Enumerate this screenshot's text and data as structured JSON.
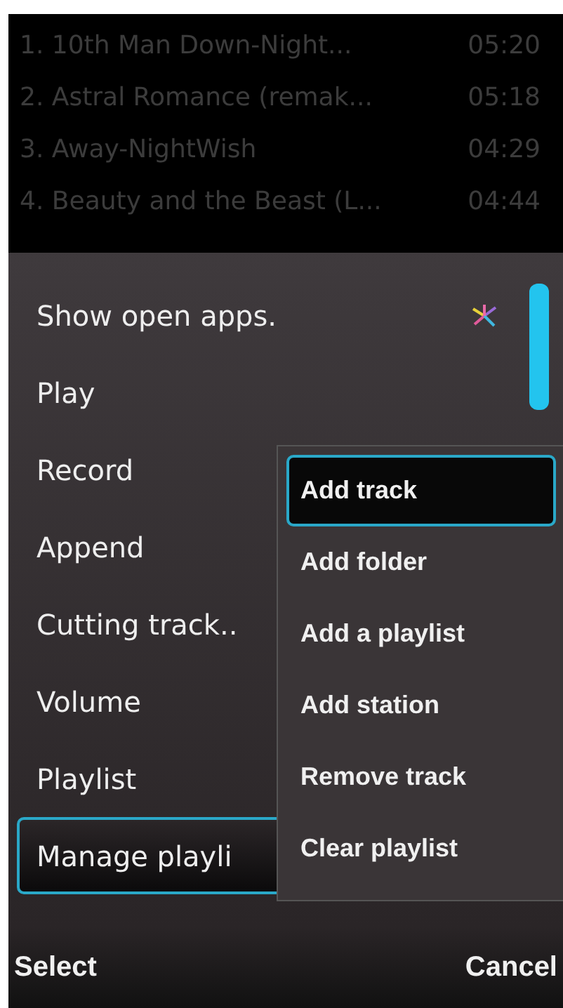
{
  "tracks": [
    {
      "title": "1. 10th Man Down-Night...",
      "duration": "05:20"
    },
    {
      "title": "2. Astral Romance (remak...",
      "duration": "05:18"
    },
    {
      "title": "3. Away-NightWish",
      "duration": "04:29"
    },
    {
      "title": "4. Beauty and the Beast (L...",
      "duration": "04:44"
    }
  ],
  "menu": {
    "items": [
      {
        "label": "Show open apps.",
        "kind": "apps",
        "selected": false
      },
      {
        "label": "Play",
        "kind": "plain",
        "selected": false
      },
      {
        "label": "Record",
        "kind": "plain",
        "selected": false
      },
      {
        "label": "Append",
        "kind": "plain",
        "selected": false
      },
      {
        "label": "Cutting track..",
        "kind": "plain",
        "selected": false
      },
      {
        "label": "Volume",
        "kind": "plain",
        "selected": false
      },
      {
        "label": "Playlist",
        "kind": "plain",
        "selected": false
      },
      {
        "label": "Manage playli",
        "kind": "plain",
        "selected": true
      }
    ]
  },
  "submenu": {
    "items": [
      {
        "label": "Add track",
        "selected": true
      },
      {
        "label": "Add folder",
        "selected": false
      },
      {
        "label": "Add a playlist",
        "selected": false
      },
      {
        "label": "Add station",
        "selected": false
      },
      {
        "label": "Remove track",
        "selected": false
      },
      {
        "label": "Clear playlist",
        "selected": false
      }
    ]
  },
  "softkeys": {
    "left": "Select",
    "right": "Cancel"
  }
}
